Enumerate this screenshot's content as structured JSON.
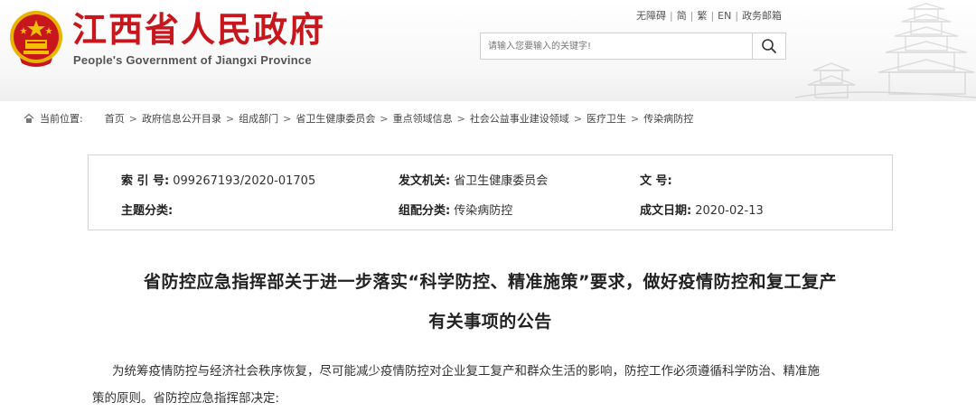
{
  "header": {
    "title": "江西省人民政府",
    "subtitle": "People's Government of Jiangxi Province",
    "links": [
      "无障碍",
      "简",
      "繁",
      "EN",
      "政务邮箱"
    ],
    "search_placeholder": "请输入您要输入的关键字!"
  },
  "breadcrumb": {
    "label": "当前位置:",
    "items": [
      "首页",
      "政府信息公开目录",
      "组成部门",
      "省卫生健康委员会",
      "重点领域信息",
      "社会公益事业建设领域",
      "医疗卫生",
      "传染病防控"
    ]
  },
  "meta": {
    "index_label": "索 引 号:",
    "index_value": "099267193/2020-01705",
    "issuer_label": "发文机关:",
    "issuer_value": "省卫生健康委员会",
    "doc_no_label": "文 号:",
    "doc_no_value": "",
    "subject_label": "主题分类:",
    "subject_value": "",
    "category_label": "组配分类:",
    "category_value": "传染病防控",
    "date_label": "成文日期:",
    "date_value": "2020-02-13"
  },
  "article": {
    "title_line1": "省防控应急指挥部关于进一步落实“科学防控、精准施策”要求，做好疫情防控和复工复产",
    "title_line2": "有关事项的公告",
    "body_line1": "为统筹疫情防控与经济社会秩序恢复，尽可能减少疫情防控对企业复工复产和群众生活的影响，防控工作必须遵循科学防治、精准施",
    "body_line2": "策的原则。省防控应急指挥部决定:"
  },
  "colors": {
    "brand_red": "#c8161d",
    "emblem_gold": "#f2c000"
  }
}
